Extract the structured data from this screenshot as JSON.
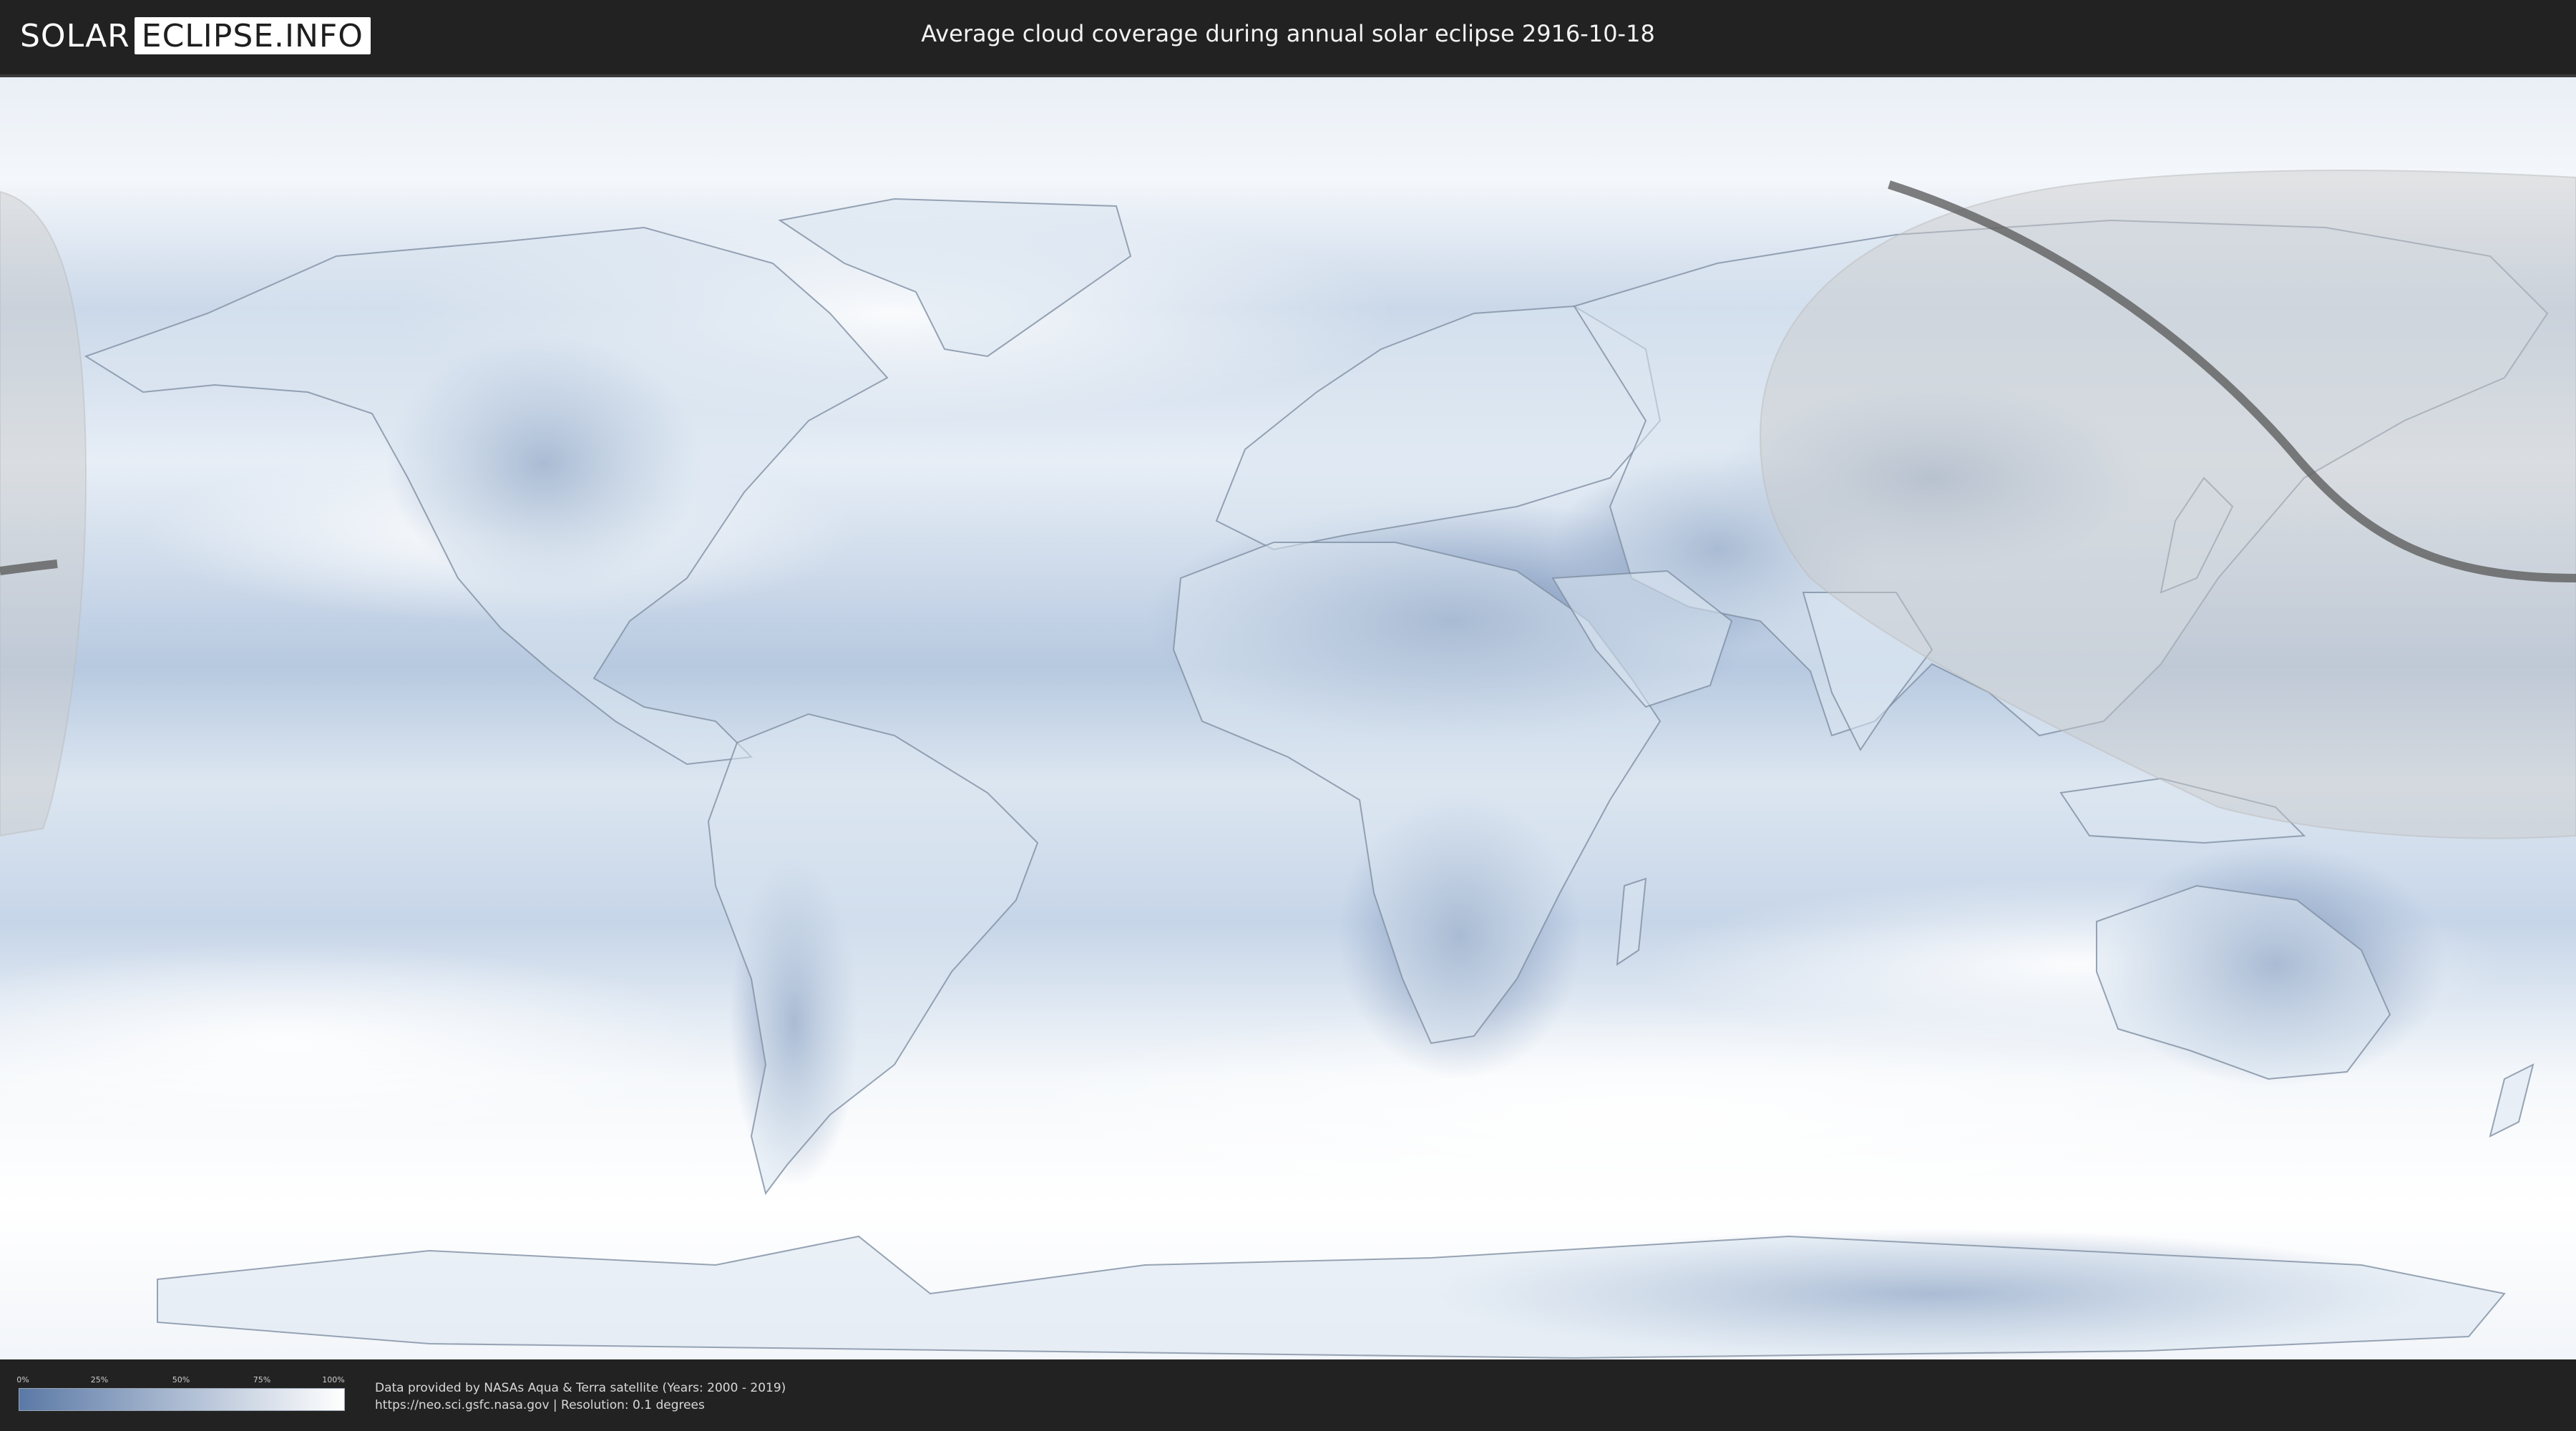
{
  "header": {
    "logo_left": "SOLAR",
    "logo_right": "ECLIPSE.INFO",
    "title": "Average cloud coverage during annual solar eclipse 2916-10-18"
  },
  "map": {
    "type": "equirectangular world map",
    "layer": "average cloud coverage",
    "eclipse_type": "annular",
    "eclipse_date": "2916-10-18",
    "colors": {
      "clear": "#5a7aa8",
      "cloudy": "#ffffff",
      "visibility_overlay": "#c9c9c9",
      "center_line": "#555555"
    }
  },
  "legend": {
    "ticks": [
      "0%",
      "25%",
      "50%",
      "75%",
      "100%"
    ],
    "color_start": "#5b79a6",
    "color_end": "#ffffff"
  },
  "credits": {
    "line1": "Data provided by NASAs Aqua & Terra satellite (Years: 2000 - 2019)",
    "line2": "https://neo.sci.gsfc.nasa.gov | Resolution: 0.1 degrees"
  }
}
